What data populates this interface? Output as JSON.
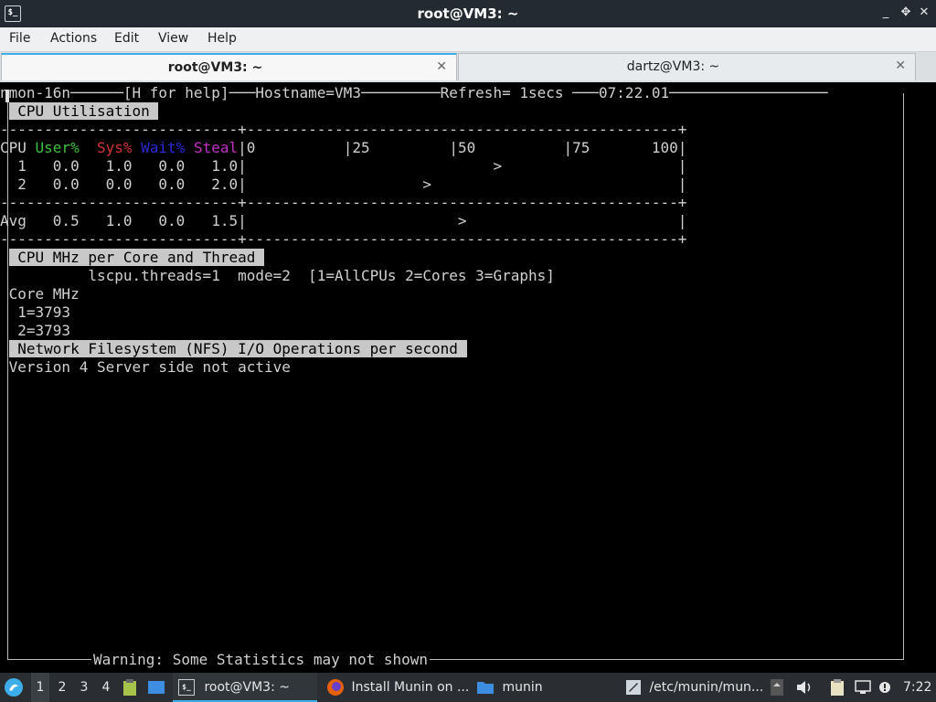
{
  "window": {
    "title": "root@VM3: ~",
    "minimize_glyph": "_",
    "maximize_glyph": "✥",
    "restore_glyph": "⊡",
    "close_glyph": "✕",
    "icon_text": "$_"
  },
  "menubar": {
    "file": "File",
    "actions": "Actions",
    "edit": "Edit",
    "view": "View",
    "help": "Help"
  },
  "tabs": [
    {
      "label": "root@VM3: ~",
      "close": "✕",
      "active": true
    },
    {
      "label": "dartz@VM3: ~",
      "close": "✕",
      "active": false
    }
  ],
  "nmon": {
    "topbar": "nmon-16n──────[H for help]───Hostname=VM3─────────Refresh= 1secs ───07:22.01──────────────────",
    "cpu_util_title": " CPU Utilisation ",
    "sep_line": "---------------------------+-------------------------------------------------+",
    "cpu_hdr": {
      "cpu": "CPU ",
      "user": "User%",
      "sys": "Sys%",
      "wait": "Wait%",
      "steal": "Steal",
      "scale": "|0          |25         |50          |75       100|"
    },
    "rows": [
      {
        "text": "  1   0.0   1.0   0.0   1.0|                            >                    |"
      },
      {
        "text": "  2   0.0   0.0   0.0   2.0|                    >                            |"
      }
    ],
    "avg": {
      "text": "Avg   0.5   1.0   0.0   1.5|                        >                        |"
    },
    "mhz_title": " CPU MHz per Core and Thread ",
    "mhz_info": "          lscpu.threads=1  mode=2  [1=AllCPUs 2=Cores 3=Graphs]",
    "core_mhz_label": " Core MHz",
    "cores": [
      "  1=3793",
      "  2=3793"
    ],
    "nfs_title": " Network Filesystem (NFS) I/O Operations per second ",
    "nfs_msg": " Version 4 Server side not active",
    "footer": "Warning: Some Statistics may not shown"
  },
  "taskbar": {
    "desktops": [
      "1",
      "2",
      "3",
      "4"
    ],
    "tasks": [
      {
        "label": "root@VM3: ~",
        "icon": "terminal-icon"
      },
      {
        "label": "Install Munin on ...",
        "icon": "firefox-icon"
      },
      {
        "label": "munin",
        "icon": "folder-icon"
      },
      {
        "label": "/etc/munin/mun...",
        "icon": "text-editor-icon"
      }
    ],
    "clock": "7:22"
  },
  "colors": {
    "accent": "#3daee9",
    "user": "#3cc13c",
    "sys": "#d23434",
    "wait": "#2a2ad8",
    "steal": "#c332c3"
  }
}
